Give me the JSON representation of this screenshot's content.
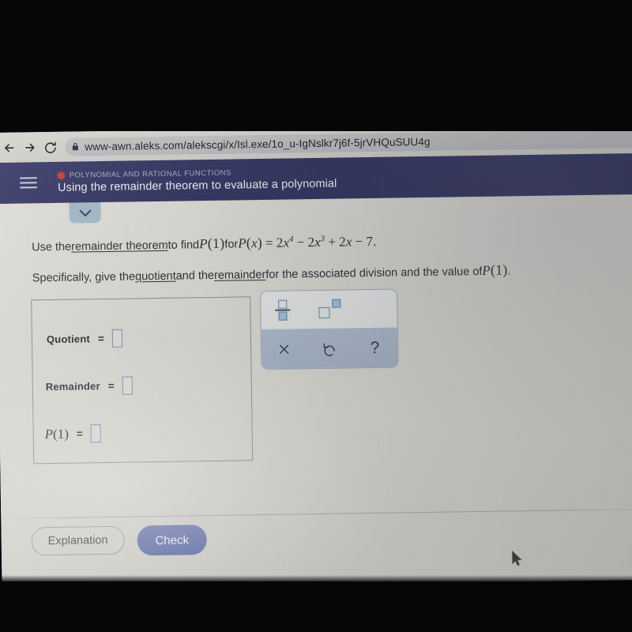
{
  "browser": {
    "back_icon": "arrow-left-icon",
    "forward_icon": "arrow-right-icon",
    "reload_icon": "reload-icon",
    "lock_icon": "lock-icon",
    "url": "www-awn.aleks.com/alekscgi/x/Isl.exe/1o_u-IgNslkr7j6f-5jrVHQuSUU4g"
  },
  "header": {
    "menu_icon": "hamburger-menu-icon",
    "topic_dot_color": "#c0392b",
    "topic": "POLYNOMIAL AND RATIONAL FUNCTIONS",
    "title": "Using the remainder theorem to evaluate a polynomial",
    "background_color": "#2b2f5e"
  },
  "collapse_tab": {
    "icon": "chevron-down-icon",
    "color": "#9fb7c4"
  },
  "statement": {
    "line1": {
      "prefix": "Use the ",
      "link1": "remainder theorem",
      "middle": " to find ",
      "math_p1": "P(1)",
      "middle2": " for ",
      "math_px": "P(x) = 2x⁴ − 2x³ + 2x − 7.",
      "poly_coeffs": [
        "2x^4",
        "-2x^3",
        "+2x",
        "-7"
      ],
      "parts": {
        "P": "P",
        "x_paren": "(x)",
        "equals": "=",
        "t1_coef": "2",
        "t1_var": "x",
        "t1_exp": "4",
        "t2_op": "−",
        "t2_coef": "2",
        "t2_var": "x",
        "t2_exp": "3",
        "t3_op": "+",
        "t3_coef": "2",
        "t3_var": "x",
        "t4_op": "−",
        "t4_const": "7.",
        "one_paren": "(1)"
      }
    },
    "line2": {
      "prefix": "Specifically, give the ",
      "link1": "quotient",
      "middle": " and the ",
      "link2": "remainder",
      "suffix": " for the associated division and the value of ",
      "math_p1": "P(1)",
      "period": "."
    }
  },
  "answer_box": {
    "rows": [
      {
        "label": "Quotient",
        "equals": "=",
        "value": "",
        "input_name": "quotient-input"
      },
      {
        "label": "Remainder",
        "equals": "=",
        "value": "",
        "input_name": "remainder-input"
      }
    ],
    "p_row": {
      "label_P": "P",
      "label_arg": "(1)",
      "equals": "=",
      "value": "",
      "input_name": "p-of-1-input"
    }
  },
  "palette": {
    "templates": [
      {
        "name": "fraction-template-button",
        "icon": "fraction-icon"
      },
      {
        "name": "exponent-template-button",
        "icon": "exponent-icon"
      }
    ],
    "actions": [
      {
        "name": "clear-button",
        "icon": "close-x-icon",
        "glyph": "×"
      },
      {
        "name": "undo-button",
        "icon": "undo-icon",
        "glyph": "↺"
      },
      {
        "name": "help-button",
        "icon": "question-mark-icon",
        "glyph": "?"
      }
    ],
    "accent_color": "#9dc0dc",
    "bar_color": "#a3b1c4"
  },
  "footer": {
    "explanation_label": "Explanation",
    "check_label": "Check",
    "check_color": "#6b79b0"
  },
  "cursor": {
    "icon": "mouse-pointer-icon"
  },
  "page_background_color": "#d4d3ce"
}
